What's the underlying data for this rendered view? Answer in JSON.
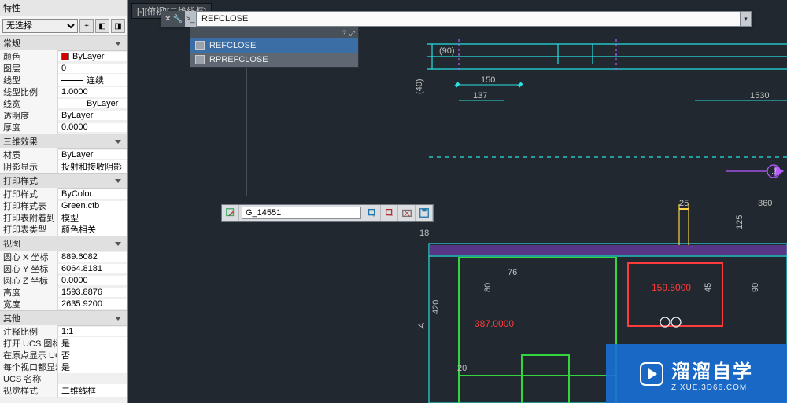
{
  "palette": {
    "title": "特性",
    "selection": {
      "value": "无选择",
      "icons": [
        "+",
        "◧",
        "◨"
      ]
    },
    "cats": [
      {
        "title": "常规",
        "rows": [
          {
            "k": "颜色",
            "v": "ByLayer",
            "swatch": "#d40000"
          },
          {
            "k": "图层",
            "v": "0"
          },
          {
            "k": "线型",
            "v": "连续",
            "line": true
          },
          {
            "k": "线型比例",
            "v": "1.0000"
          },
          {
            "k": "线宽",
            "v": "ByLayer",
            "line": true
          },
          {
            "k": "透明度",
            "v": "ByLayer"
          },
          {
            "k": "厚度",
            "v": "0.0000"
          }
        ]
      },
      {
        "title": "三维效果",
        "rows": [
          {
            "k": "材质",
            "v": "ByLayer"
          },
          {
            "k": "阴影显示",
            "v": "投射和接收阴影"
          }
        ]
      },
      {
        "title": "打印样式",
        "rows": [
          {
            "k": "打印样式",
            "v": "ByColor"
          },
          {
            "k": "打印样式表",
            "v": "Green.ctb"
          },
          {
            "k": "打印表附着到",
            "v": "模型"
          },
          {
            "k": "打印表类型",
            "v": "颜色相关"
          }
        ]
      },
      {
        "title": "视图",
        "rows": [
          {
            "k": "圆心 X 坐标",
            "v": "889.6082"
          },
          {
            "k": "圆心 Y 坐标",
            "v": "6064.8181"
          },
          {
            "k": "圆心 Z 坐标",
            "v": "0.0000"
          },
          {
            "k": "高度",
            "v": "1593.8876"
          },
          {
            "k": "宽度",
            "v": "2635.9200"
          }
        ]
      },
      {
        "title": "其他",
        "rows": [
          {
            "k": "注释比例",
            "v": "1:1"
          },
          {
            "k": "打开 UCS 图标",
            "v": "是"
          },
          {
            "k": "在原点显示 UC...",
            "v": "否"
          },
          {
            "k": "每个视口都显示...",
            "v": "是"
          },
          {
            "k": "UCS 名称",
            "v": ""
          },
          {
            "k": "视觉样式",
            "v": "二维线框"
          }
        ]
      }
    ]
  },
  "viewport": {
    "label": "[-][俯视][二维线框]"
  },
  "cmd": {
    "input": "REFCLOSE",
    "prompt": ">_"
  },
  "suggest": {
    "items": [
      {
        "label": "REFCLOSE",
        "sel": true
      },
      {
        "label": "RPREFCLOSE",
        "sel": false
      }
    ]
  },
  "edit_toolbar": {
    "layer_value": "G_14551"
  },
  "dims": {
    "d1": "150",
    "d2": "137",
    "d3": "1530",
    "d9": "(90)",
    "d4": "25",
    "d5": "360",
    "d6": "125",
    "d7": "(40)",
    "d8": "18",
    "v1": "420",
    "v2": "80",
    "v3": "76",
    "v4": "20",
    "v5": "45",
    "v6": "90",
    "r1": "387.0000",
    "r2": "159.5000",
    "ax1": "A",
    "ax2": "J"
  },
  "watermark": {
    "big": "溜溜自学",
    "small": "ZIXUE.3D66.COM"
  }
}
